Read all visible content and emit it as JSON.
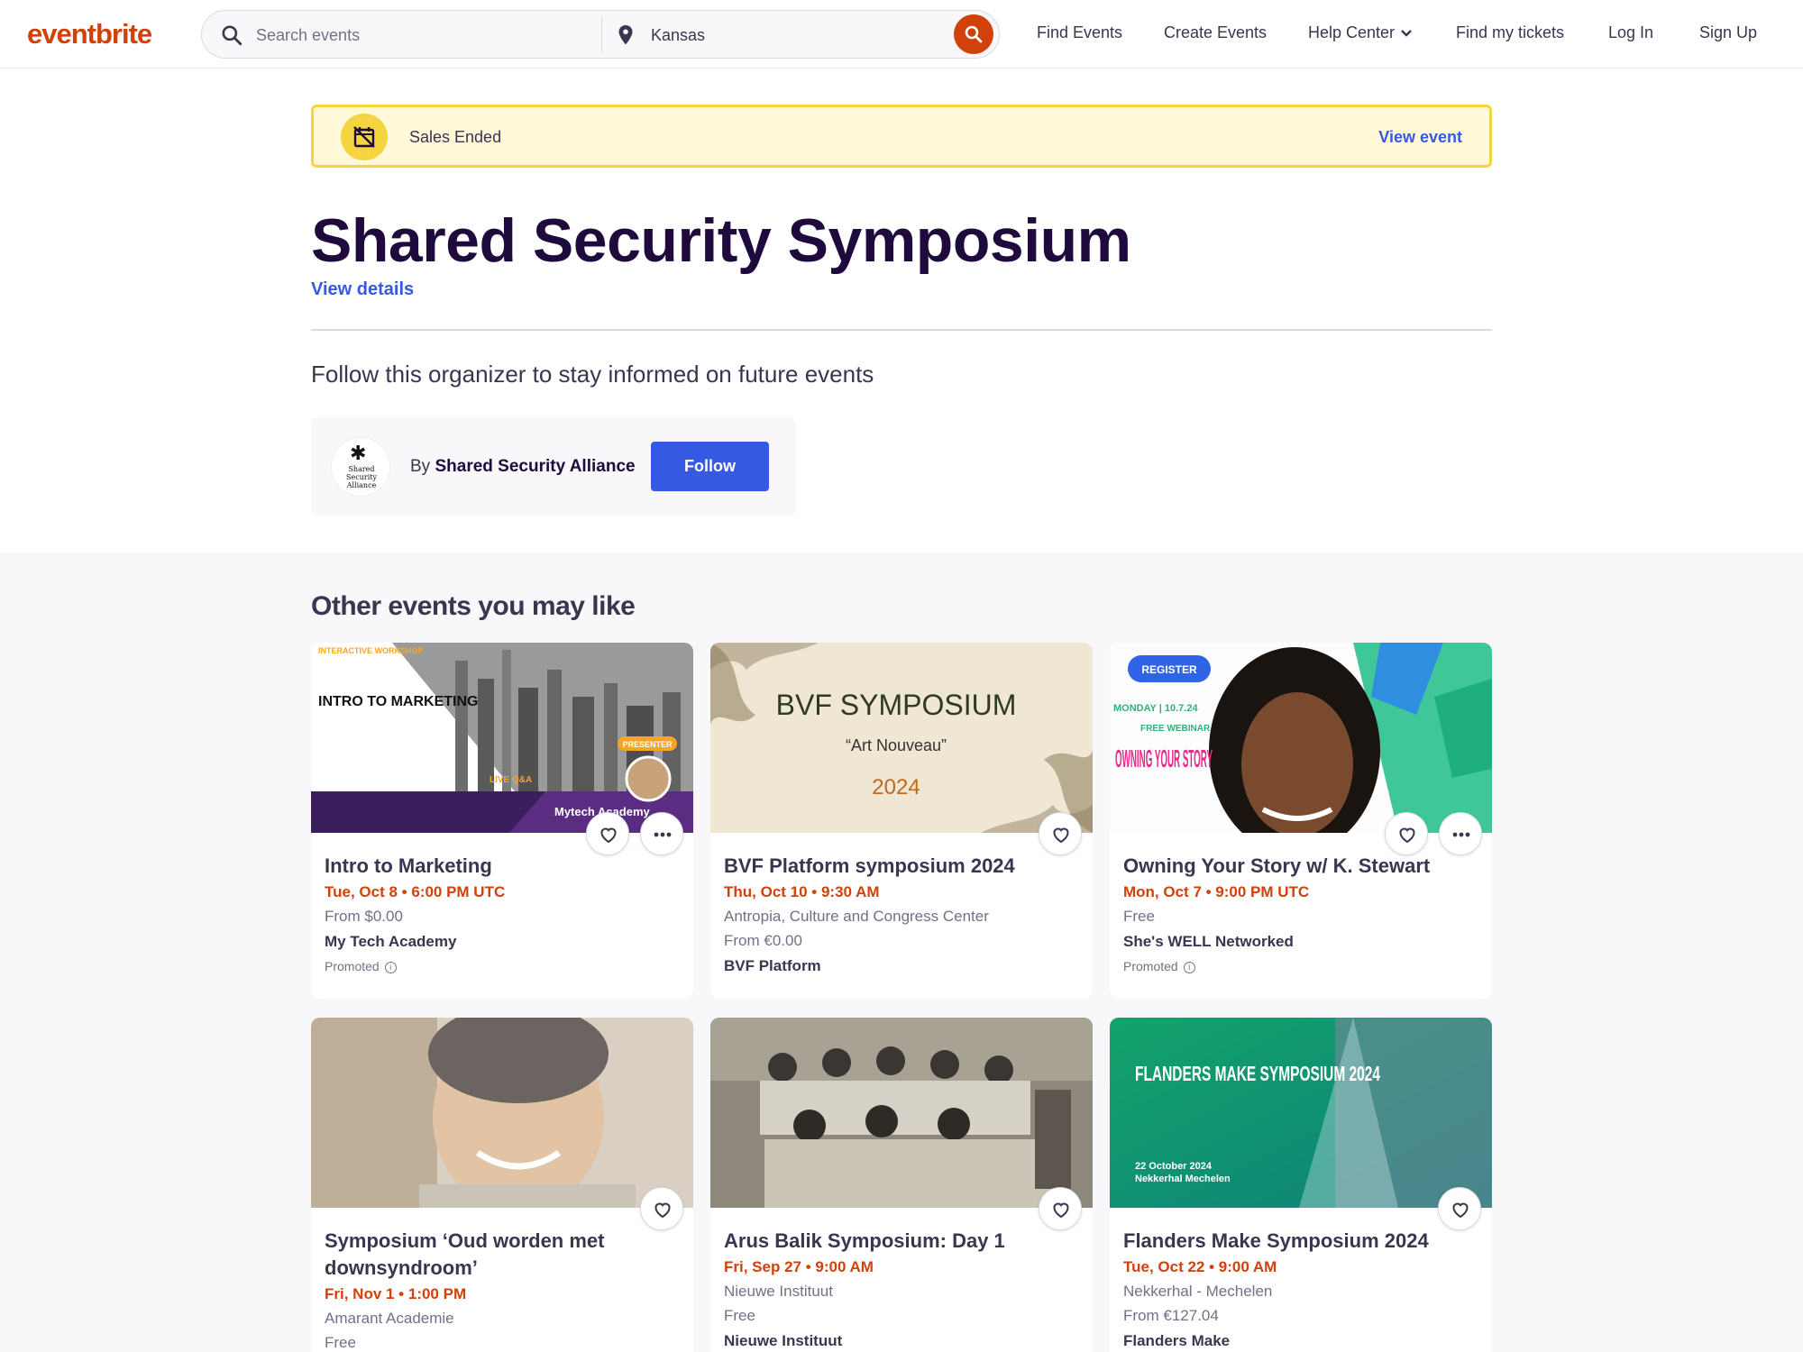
{
  "brand": {
    "logo": "eventbrite",
    "color": "#d1410c",
    "link_color": "#3659e3"
  },
  "search": {
    "placeholder": "Search events",
    "location_value": "Kansas"
  },
  "nav": {
    "find_events": "Find Events",
    "create_events": "Create Events",
    "help_center": "Help Center",
    "find_tickets": "Find my tickets",
    "log_in": "Log In",
    "sign_up": "Sign Up"
  },
  "banner": {
    "status": "Sales Ended",
    "link": "View event"
  },
  "event": {
    "title": "Shared Security Symposium",
    "view_details": "View details"
  },
  "organizer": {
    "follow_heading": "Follow this organizer to stay informed on future events",
    "by_prefix": "By",
    "name": "Shared Security Alliance",
    "avatar_text": "Shared Security Alliance",
    "follow_button": "Follow"
  },
  "other": {
    "heading": "Other events you may like",
    "cards": [
      {
        "title": "Intro to Marketing",
        "date": "Tue, Oct 8 • 6:00 PM UTC",
        "price": "From $0.00",
        "organizer": "My Tech Academy",
        "promoted": "Promoted",
        "img": {
          "tag": "INTERACTIVE WORKSHOP",
          "headline": "INTRO TO MARKETING",
          "badge": "PRESENTER",
          "live": "LIVE Q&A",
          "brand": "Mytech Academy"
        }
      },
      {
        "title": "BVF Platform symposium 2024",
        "date": "Thu, Oct 10 • 9:30 AM",
        "venue": "Antropia, Culture and Congress Center",
        "price": "From €0.00",
        "organizer": "BVF Platform",
        "img": {
          "headline": "BVF SYMPOSIUM",
          "subtitle": "“Art Nouveau”",
          "year": "2024"
        }
      },
      {
        "title": "Owning Your Story w/ K. Stewart",
        "date": "Mon, Oct 7 • 9:00 PM UTC",
        "price": "Free",
        "organizer": "She's WELL Networked",
        "promoted": "Promoted",
        "img": {
          "register": "REGISTER",
          "date": "MONDAY | 10.7.24",
          "webinar": "FREE WEBINAR",
          "headline": "OWNING YOUR STORY"
        }
      },
      {
        "title": "Symposium ‘Oud worden met downsyndroom’",
        "date": "Fri, Nov 1 • 1:00 PM",
        "venue": "Amarant Academie",
        "price": "Free"
      },
      {
        "title": "Arus Balik Symposium: Day 1",
        "date": "Fri, Sep 27 • 9:00 AM",
        "venue": "Nieuwe Instituut",
        "price": "Free",
        "organizer": "Nieuwe Instituut"
      },
      {
        "title": "Flanders Make Symposium 2024",
        "date": "Tue, Oct 22 • 9:00 AM",
        "venue": "Nekkerhal - Mechelen",
        "price": "From €127.04",
        "organizer": "Flanders Make",
        "img": {
          "headline": "FLANDERS MAKE SYMPOSIUM 2024",
          "date": "22 October 2024",
          "place": "Nekkerhal Mechelen"
        }
      }
    ]
  }
}
